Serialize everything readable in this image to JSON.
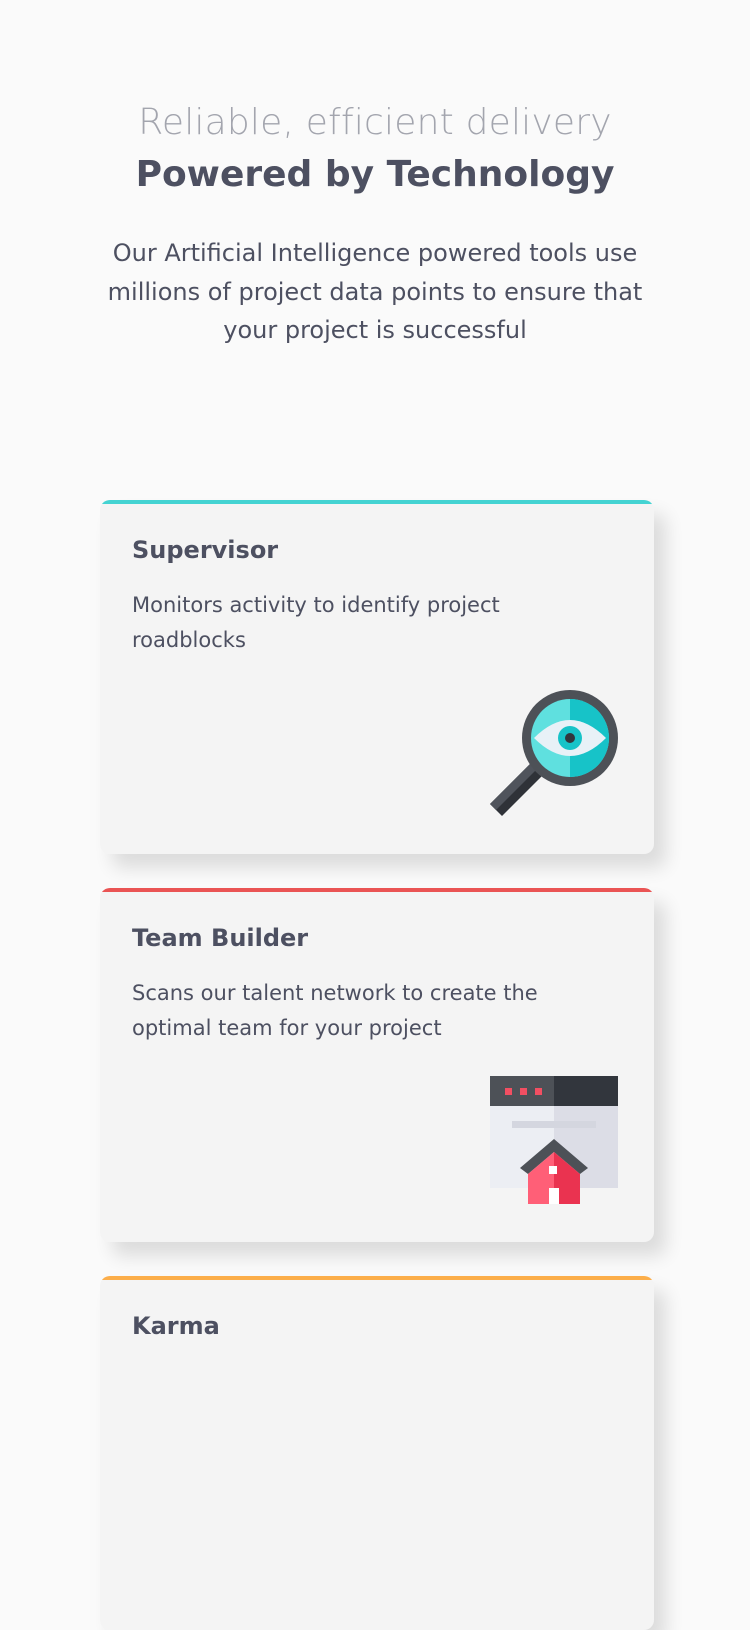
{
  "hero": {
    "subtitle": "Reliable, efficient delivery",
    "title": "Powered by Technology",
    "description": "Our Artificial Intelligence powered tools use millions of project data points to ensure that your project is successful"
  },
  "cards": [
    {
      "title": "Supervisor",
      "text": "Monitors activity to identify project roadblocks",
      "accent": "#44d3d2",
      "icon": "magnifier-eye-icon"
    },
    {
      "title": "Team Builder",
      "text": "Scans our talent network to create the optimal team for your project",
      "accent": "#ea5454",
      "icon": "browser-house-icon"
    },
    {
      "title": "Karma",
      "text": "",
      "accent": "#fcae4a",
      "icon": ""
    }
  ]
}
